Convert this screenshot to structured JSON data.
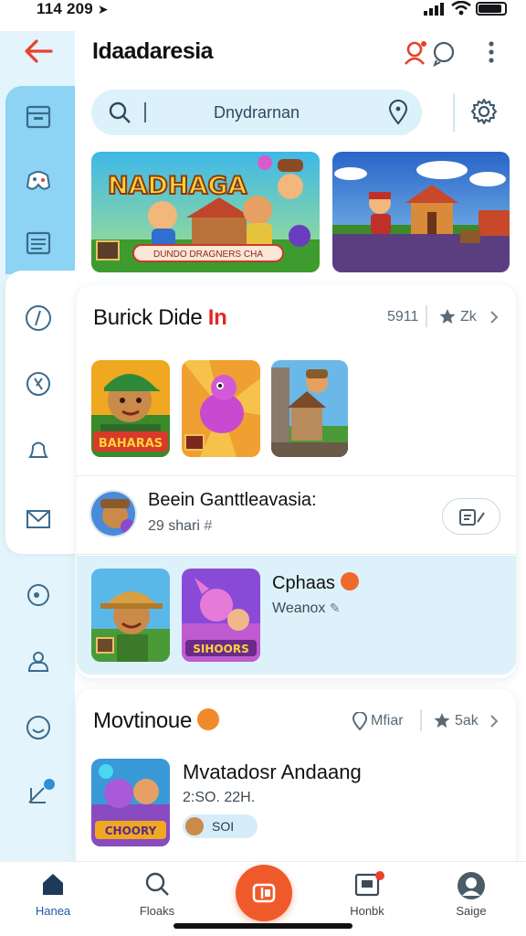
{
  "status_bar": {
    "time": "114 209"
  },
  "header": {
    "title": "Idaadaresia"
  },
  "search": {
    "placeholder": "Dnydrarnan"
  },
  "section1": {
    "title": "Burick Dide",
    "title_accent": "In",
    "count": "5911",
    "rating": "Zk"
  },
  "banner1": {
    "title": "NADHAGA",
    "caption": "DUNDO DRAGNERS CHA"
  },
  "thumb1": {
    "label": "BAHARAS"
  },
  "list_item": {
    "title": "Beein Ganttleavasia:",
    "subtitle": "29 shari"
  },
  "highlight": {
    "title": "Cphaas",
    "subtitle": "Weanox",
    "thumb_label": "SIHOORS"
  },
  "section2": {
    "title": "Movtinoue",
    "filter_label": "Mfiar",
    "rating": "5ak"
  },
  "featured": {
    "title": "Mvatadosr Andaang",
    "meta": "2:SO. 22H.",
    "badge": "SOI",
    "thumb_label": "CHOORY"
  },
  "bottom_nav": [
    {
      "label": "Hanea",
      "icon": "home-icon"
    },
    {
      "label": "Floaks",
      "icon": "search-icon"
    },
    {
      "label": "Honbk",
      "icon": "inbox-icon"
    },
    {
      "label": "Saige",
      "icon": "profile-icon"
    }
  ],
  "colors": {
    "accent": "#ef5a2a",
    "rail": "#8cd3f4",
    "search_bg": "#ddf1fb"
  }
}
